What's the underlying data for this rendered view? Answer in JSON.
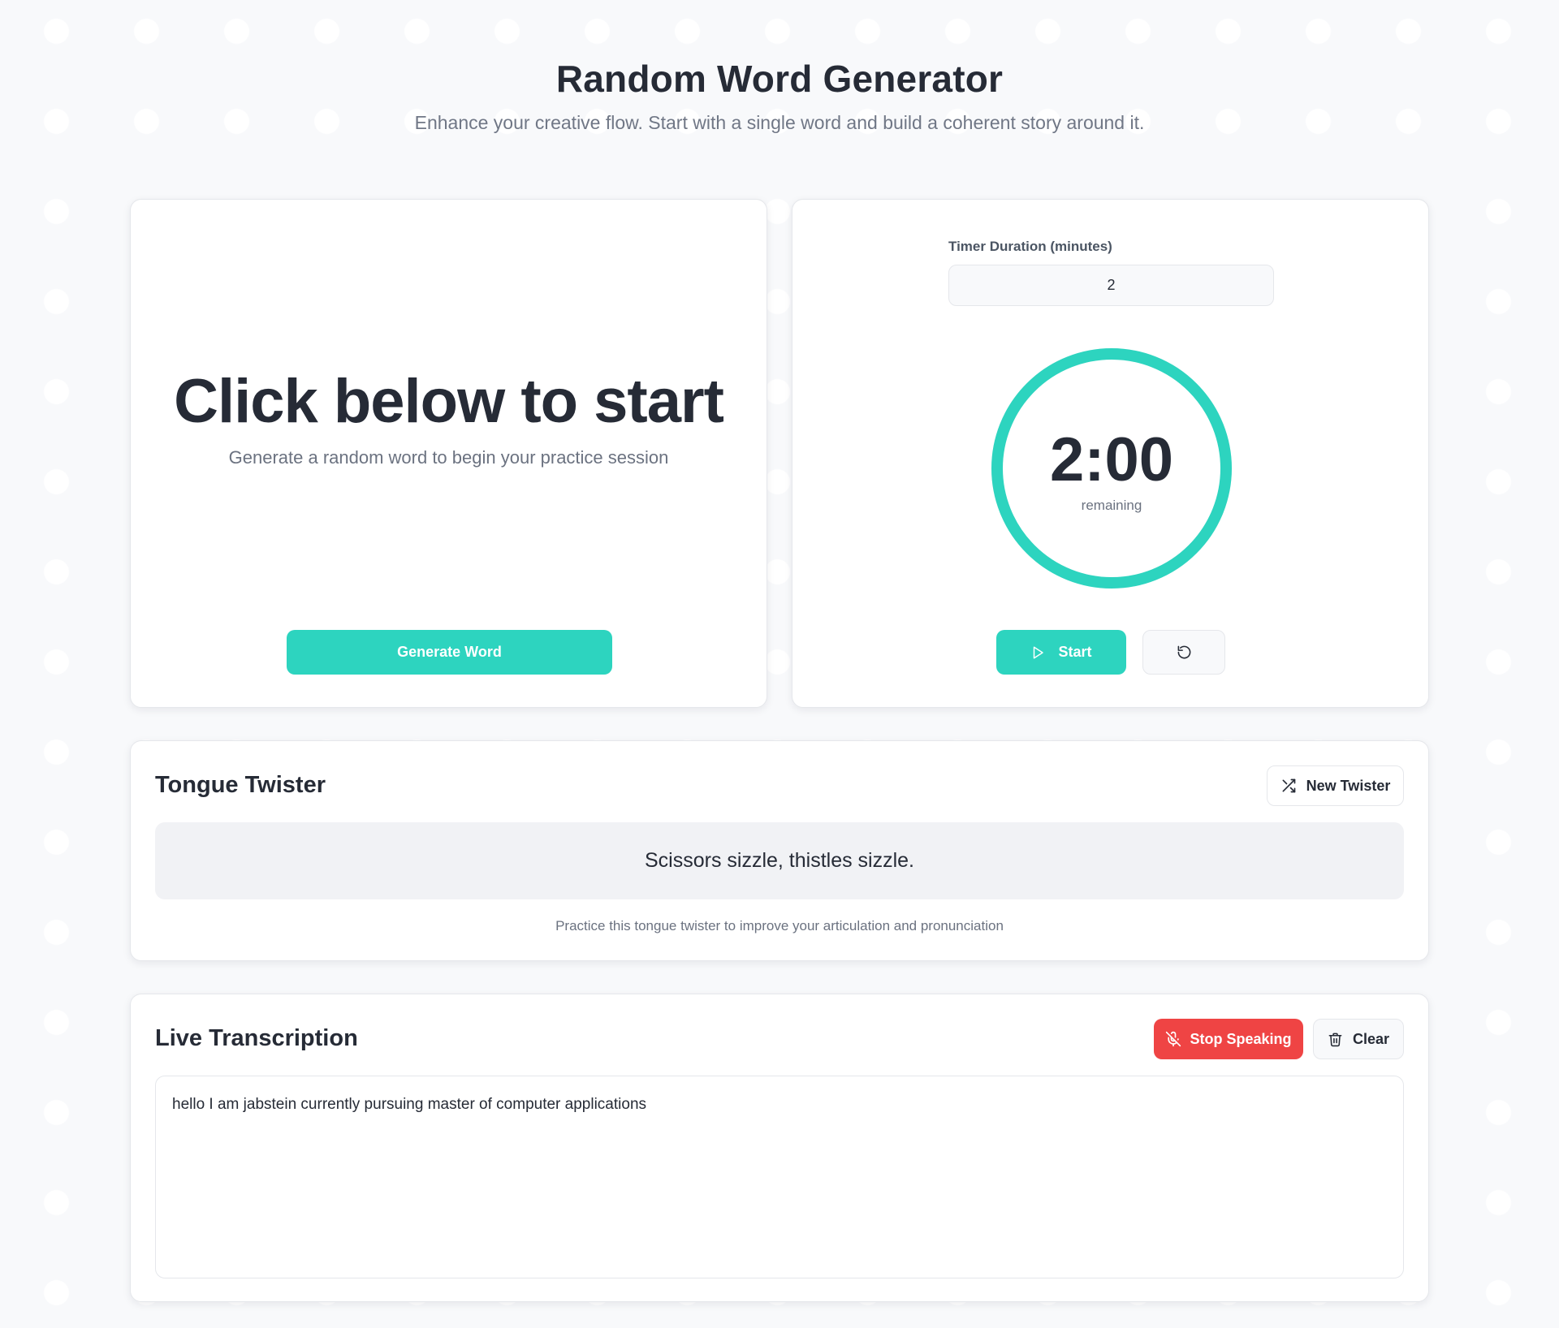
{
  "header": {
    "title": "Random Word Generator",
    "subtitle": "Enhance your creative flow. Start with a single word and build a coherent story around it."
  },
  "word_card": {
    "prompt_title": "Click below to start",
    "prompt_subtitle": "Generate a random word to begin your practice session",
    "generate_label": "Generate Word"
  },
  "timer_card": {
    "duration_label": "Timer Duration (minutes)",
    "duration_value": "2",
    "time_display": "2:00",
    "time_caption": "remaining",
    "progress": 1.0,
    "start_label": "Start"
  },
  "twister_card": {
    "title": "Tongue Twister",
    "new_twister_label": "New Twister",
    "twister_text": "Scissors sizzle, thistles sizzle.",
    "note": "Practice this tongue twister to improve your articulation and pronunciation"
  },
  "transcript_card": {
    "title": "Live Transcription",
    "stop_label": "Stop Speaking",
    "clear_label": "Clear",
    "transcript_text": "hello I am jabstein currently pursuing master of computer applications"
  },
  "colors": {
    "accent": "#2dd4bf",
    "danger": "#ef4444",
    "text": "#262b36",
    "muted": "#6b7280"
  },
  "icons": {
    "start": "play-icon",
    "reset": "reset-icon",
    "new_twister": "shuffle-icon",
    "stop": "mic-off-icon",
    "clear": "trash-icon"
  }
}
